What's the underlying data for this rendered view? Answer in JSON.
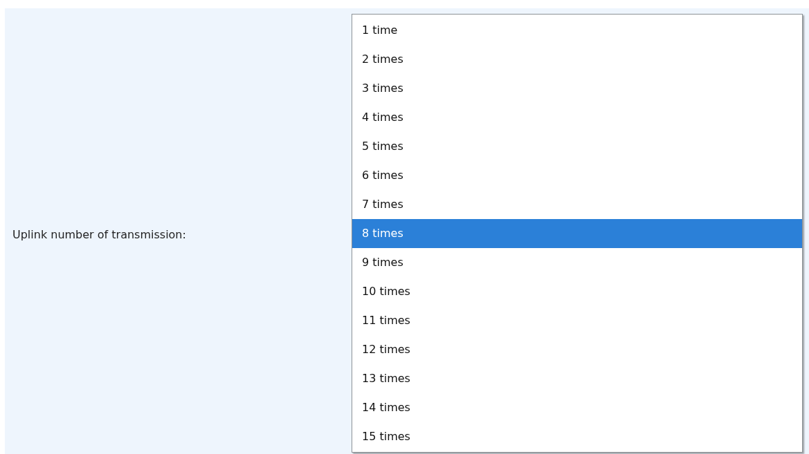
{
  "label": "Uplink number of transmission:",
  "options": [
    {
      "label": "1 time",
      "selected": false
    },
    {
      "label": "2 times",
      "selected": false
    },
    {
      "label": "3 times",
      "selected": false
    },
    {
      "label": "4 times",
      "selected": false
    },
    {
      "label": "5 times",
      "selected": false
    },
    {
      "label": "6 times",
      "selected": false
    },
    {
      "label": "7 times",
      "selected": false
    },
    {
      "label": "8 times",
      "selected": true
    },
    {
      "label": "9 times",
      "selected": false
    },
    {
      "label": "10 times",
      "selected": false
    },
    {
      "label": "11 times",
      "selected": false
    },
    {
      "label": "12 times",
      "selected": false
    },
    {
      "label": "13 times",
      "selected": false
    },
    {
      "label": "14 times",
      "selected": false
    },
    {
      "label": "15 times",
      "selected": false
    }
  ]
}
